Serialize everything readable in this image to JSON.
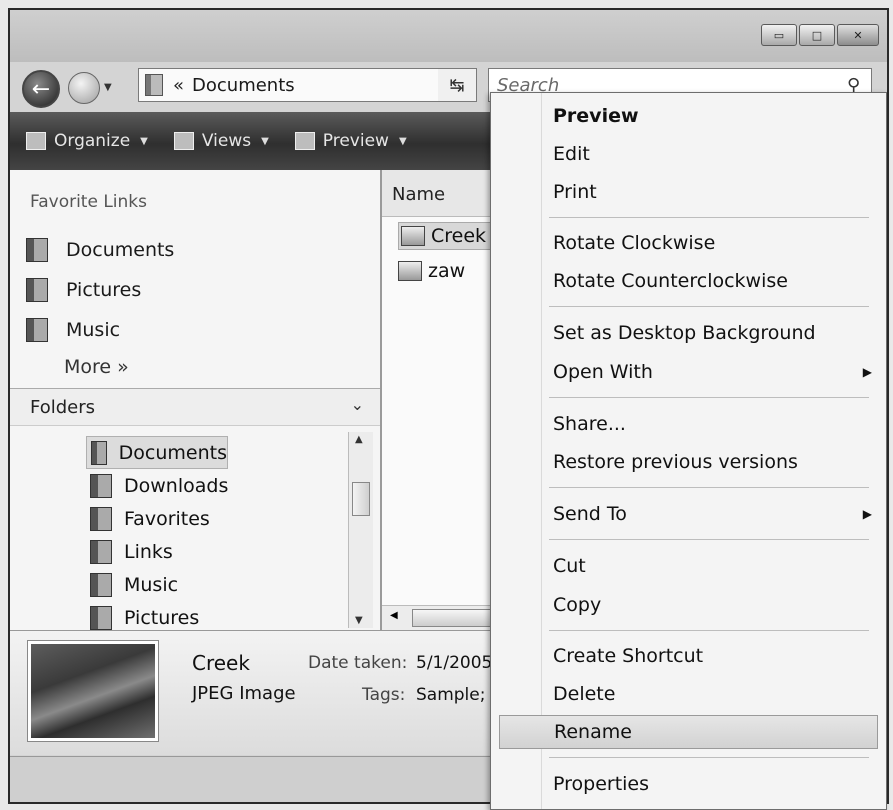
{
  "window": {
    "minimize_glyph": "▭",
    "maximize_glyph": "□",
    "close_glyph": "✕"
  },
  "nav": {
    "back_glyph": "←",
    "address_prefix": "«",
    "address_path": "Documents",
    "search_placeholder": "Search",
    "search_icon": "magnifier-icon",
    "refresh_glyph": "↹"
  },
  "toolbar": {
    "organize": "Organize",
    "views": "Views",
    "preview": "Preview"
  },
  "favorites": {
    "header": "Favorite Links",
    "items": [
      {
        "label": "Documents",
        "icon": "documents-folder-icon"
      },
      {
        "label": "Pictures",
        "icon": "pictures-folder-icon"
      },
      {
        "label": "Music",
        "icon": "music-folder-icon"
      }
    ],
    "more": "More »"
  },
  "folders": {
    "header": "Folders",
    "items": [
      "Documents",
      "Downloads",
      "Favorites",
      "Links",
      "Music",
      "Pictures"
    ]
  },
  "files": {
    "column": "Name",
    "items": [
      "Creek",
      "zaw"
    ]
  },
  "details": {
    "name": "Creek",
    "type": "JPEG Image",
    "date_label": "Date taken:",
    "date_value": "5/1/2005",
    "tags_label": "Tags:",
    "tags_value": "Sample; l"
  },
  "context_menu": {
    "items": [
      {
        "label": "Preview",
        "bold": true
      },
      {
        "label": "Edit"
      },
      {
        "label": "Print"
      },
      {
        "label": "Rotate Clockwise"
      },
      {
        "label": "Rotate Counterclockwise"
      },
      {
        "label": "Set as Desktop Background"
      },
      {
        "label": "Open With",
        "submenu": true
      },
      {
        "label": "Share..."
      },
      {
        "label": "Restore previous versions"
      },
      {
        "label": "Send To",
        "submenu": true
      },
      {
        "label": "Cut"
      },
      {
        "label": "Copy"
      },
      {
        "label": "Create Shortcut"
      },
      {
        "label": "Delete"
      },
      {
        "label": "Rename",
        "highlighted": true
      },
      {
        "label": "Properties"
      }
    ]
  },
  "colors": {
    "toolbar_dark": "#2f2f2f",
    "menu_bg": "#f4f4f4",
    "highlight": "#d2d2d2"
  }
}
